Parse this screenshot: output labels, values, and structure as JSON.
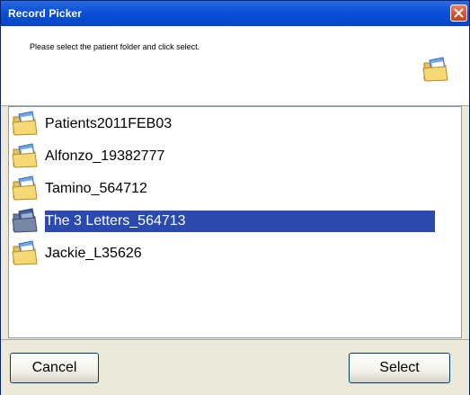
{
  "window": {
    "title": "Record Picker",
    "close_icon": "close-icon"
  },
  "header": {
    "instruction": "Please select the patient folder and click select.",
    "icon": "folder-icon"
  },
  "list": {
    "items": [
      {
        "label": "Patients2011FEB03",
        "icon": "folder-icon",
        "selected": false
      },
      {
        "label": "Alfonzo_19382777",
        "icon": "folder-icon",
        "selected": false
      },
      {
        "label": "Tamino_564712",
        "icon": "folder-icon",
        "selected": false
      },
      {
        "label": "The 3 Letters_564713",
        "icon": "folder-icon",
        "selected": true
      },
      {
        "label": "Jackie_L35626",
        "icon": "folder-icon",
        "selected": false
      }
    ]
  },
  "footer": {
    "cancel_label": "Cancel",
    "select_label": "Select"
  },
  "colors": {
    "titlebar": "#0a50d8",
    "selection": "#2a4ab0",
    "close": "#d9552c",
    "dialog_bg": "#ece9d8"
  }
}
